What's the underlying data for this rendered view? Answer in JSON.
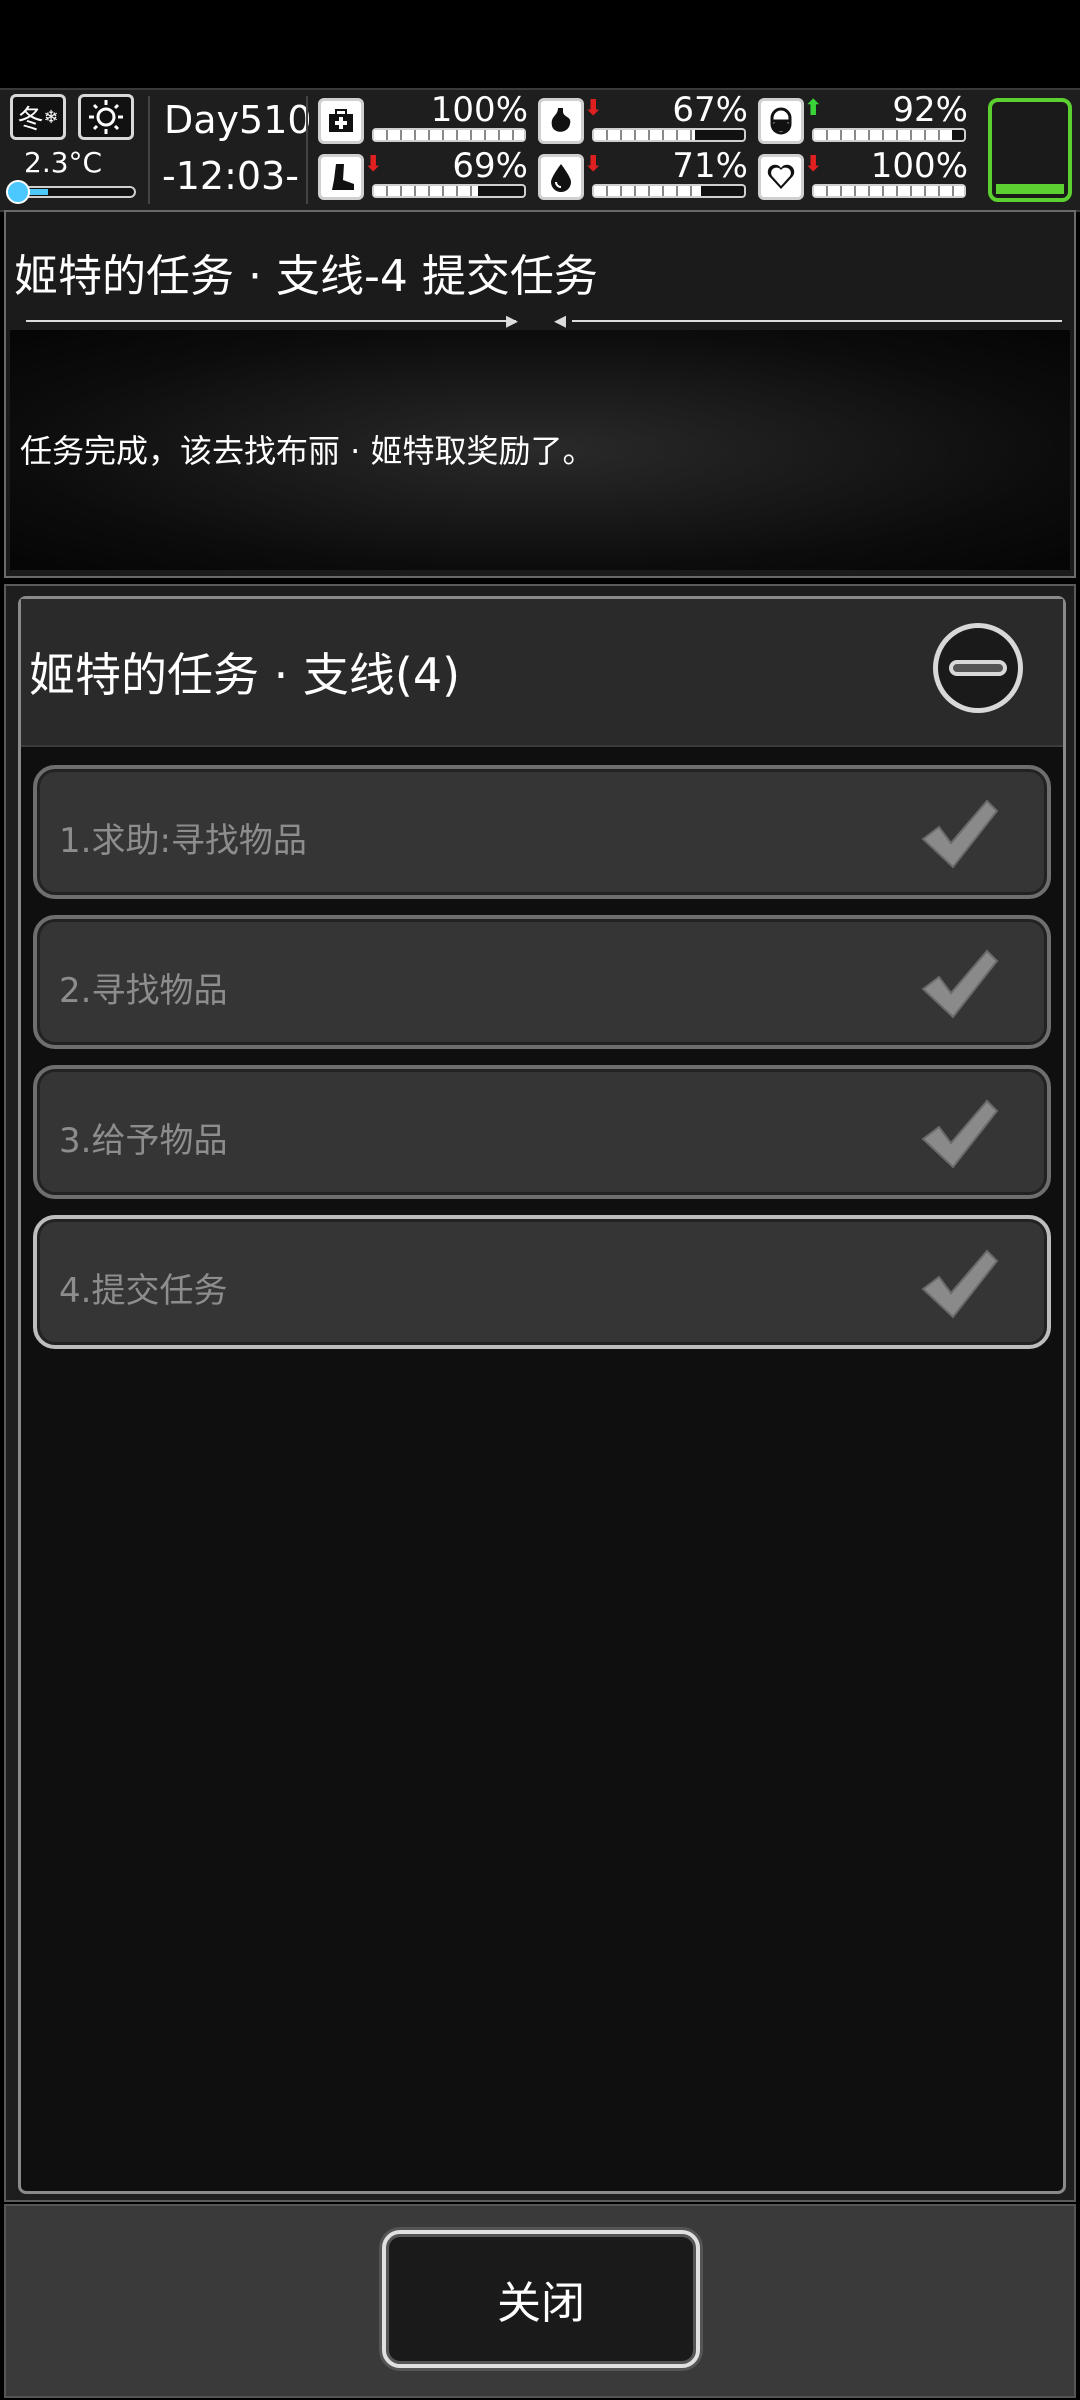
{
  "hud": {
    "season": "冬",
    "temperature": "2.3°C",
    "day": "Day510",
    "time": "-12:03-",
    "stats": [
      {
        "name": "health",
        "value": "100%",
        "fraction": 1.0,
        "arrow": "",
        "icon": "medkit-icon"
      },
      {
        "name": "hunger",
        "value": "67%",
        "fraction": 0.67,
        "arrow": "down",
        "icon": "stomach-icon"
      },
      {
        "name": "mood",
        "value": "92%",
        "fraction": 0.92,
        "arrow": "up",
        "icon": "pill-icon"
      },
      {
        "name": "stamina",
        "value": "69%",
        "fraction": 0.69,
        "arrow": "down",
        "icon": "leg-icon"
      },
      {
        "name": "thirst",
        "value": "71%",
        "fraction": 0.71,
        "arrow": "down",
        "icon": "water-drop-icon"
      },
      {
        "name": "heart",
        "value": "100%",
        "fraction": 1.0,
        "arrow": "down",
        "icon": "heart-icon"
      }
    ],
    "colors": {
      "arrow_down": "#e02020",
      "arrow_up": "#3ad43a",
      "battery": "#5cd030",
      "temp": "#4cc8ff"
    }
  },
  "title_panel": {
    "title": "姬特的任务 · 支线-4 提交任务",
    "description": "任务完成，该去找布丽 · 姬特取奖励了。"
  },
  "quest_list": {
    "header": "姬特的任务 · 支线(4)",
    "items": [
      {
        "label": "1.求助:寻找物品",
        "completed": true
      },
      {
        "label": "2.寻找物品",
        "completed": true
      },
      {
        "label": "3.给予物品",
        "completed": true
      },
      {
        "label": "4.提交任务",
        "completed": true
      }
    ]
  },
  "footer": {
    "close_label": "关闭"
  }
}
